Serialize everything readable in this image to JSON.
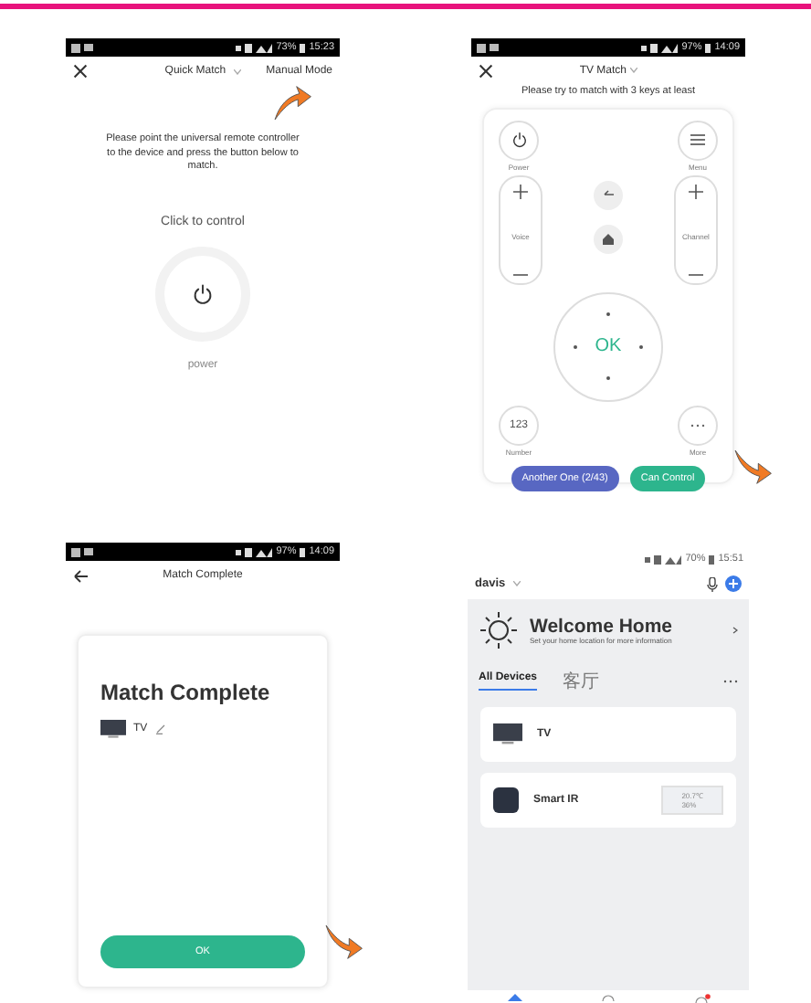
{
  "panels": [
    {
      "kind": "quick_match",
      "status_bar": {
        "battery": "73%",
        "time": "15:23"
      },
      "title": "Quick Match",
      "mode_link": "Manual Mode",
      "instruction": "Please point the universal remote controller to the device and press the button below to match.",
      "prompt": "Click to control",
      "key_label": "power"
    },
    {
      "kind": "tv_match",
      "status_bar": {
        "battery": "97%",
        "time": "14:09"
      },
      "title": "TV Match",
      "instruction": "Please try to match with 3 keys at least",
      "power_label": "Power",
      "menu_label": "Menu",
      "voice_label": "Voice",
      "channel_label": "Channel",
      "ok_label": "OK",
      "number_key": "123",
      "number_label": "Number",
      "more_label": "More",
      "buttons": [
        "Another One (2/43)",
        "Can Control"
      ]
    },
    {
      "kind": "match_complete",
      "status_bar": {
        "battery": "97%",
        "time": "14:09"
      },
      "title": "Match Complete",
      "heading": "Match Complete",
      "device_name": "TV",
      "button": "OK"
    },
    {
      "kind": "home",
      "status_bar": {
        "battery": "70%",
        "time": "15:51"
      },
      "user": "davis",
      "welcome_title": "Welcome Home",
      "welcome_subtitle": "Set your home location for more information",
      "tabs": [
        {
          "label": "All Devices",
          "selected": true
        },
        {
          "label": "客厅",
          "selected": false
        }
      ],
      "devices": [
        {
          "kind": "tv",
          "name": "TV"
        },
        {
          "kind": "ir",
          "name": "Smart IR",
          "readings": [
            "20.7℃",
            "36%"
          ]
        }
      ]
    }
  ]
}
